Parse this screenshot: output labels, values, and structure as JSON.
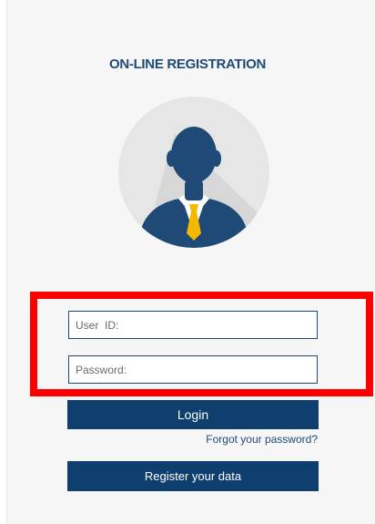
{
  "page": {
    "title": "ON-LINE REGISTRATION"
  },
  "avatar": {
    "icon": "user-avatar-icon",
    "circle_color": "#e6e6e6",
    "figure_color": "#1f4a78",
    "tie_color": "#f5b800"
  },
  "form": {
    "userid_placeholder": "User  ID:",
    "password_placeholder": "Password:",
    "login_label": "Login",
    "forgot_label": "Forgot your password?",
    "register_label": "Register your data"
  },
  "colors": {
    "brand": "#0e3f6e",
    "highlight": "#ff0000"
  }
}
